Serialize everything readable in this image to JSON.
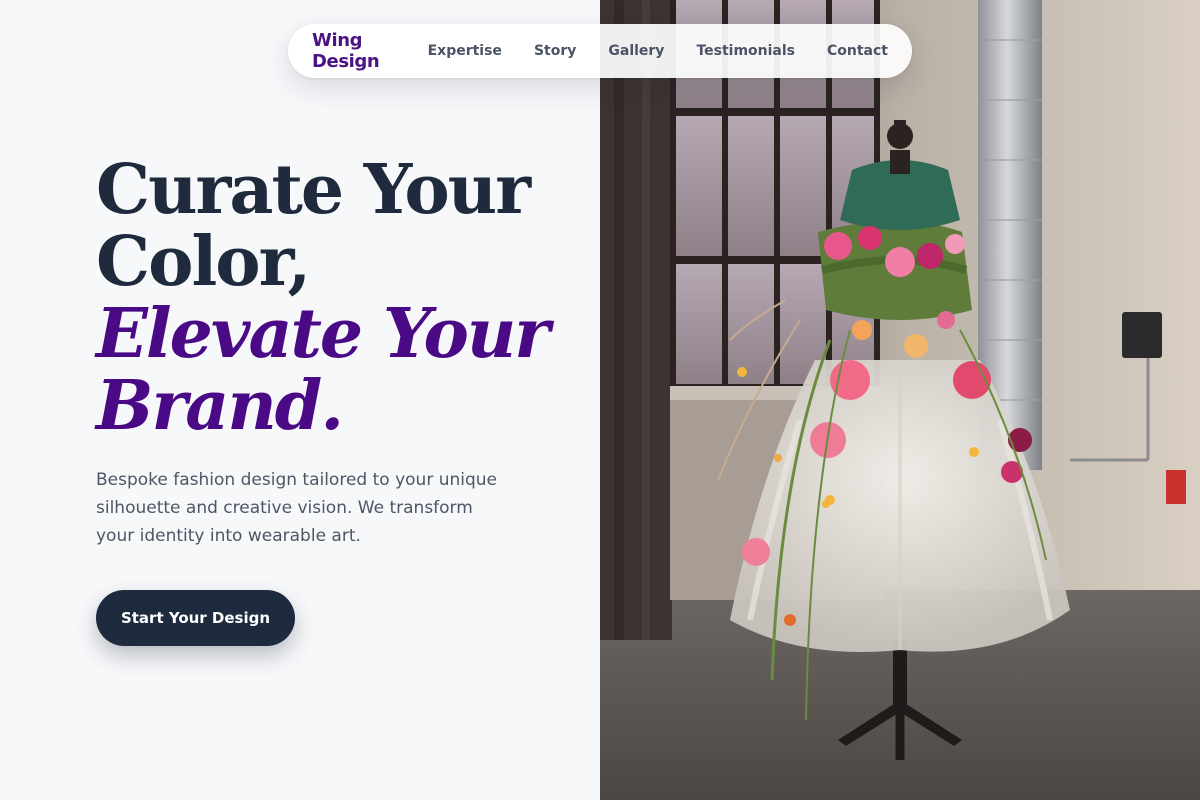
{
  "nav": {
    "brand": "Wing Design",
    "links": [
      {
        "label": "Expertise"
      },
      {
        "label": "Story"
      },
      {
        "label": "Gallery"
      },
      {
        "label": "Testimonials"
      },
      {
        "label": "Contact"
      }
    ]
  },
  "hero": {
    "headline_line1": "Curate Your",
    "headline_line2": "Color,",
    "headline_accent_line1": "Elevate Your",
    "headline_accent_line2": "Brand.",
    "description": "Bespoke fashion design tailored to your unique silhouette and creative vision. We transform your identity into wearable art.",
    "cta_label": "Start Your Design"
  },
  "colors": {
    "brand": "#4b1483",
    "accent": "#4b0a85",
    "heading": "#1f2a3d",
    "cta_bg": "#1e2a3e",
    "page_bg": "#f7f8fa"
  }
}
